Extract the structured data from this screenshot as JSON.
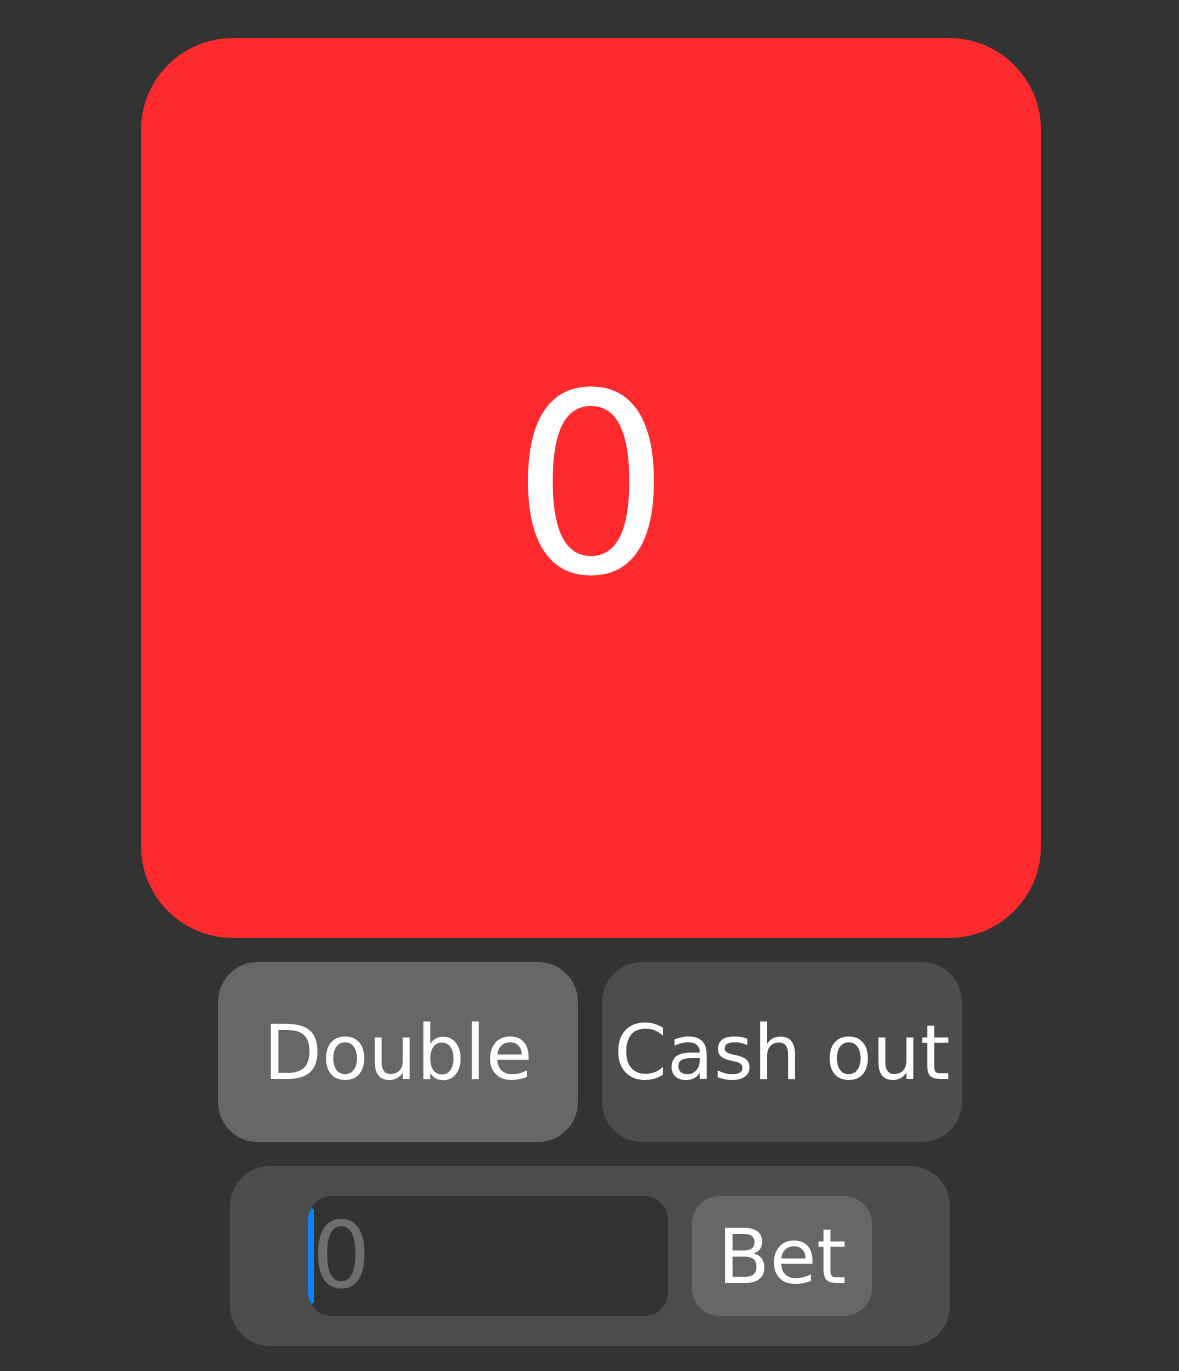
{
  "display": {
    "value": "0",
    "color": "#FF2A2D"
  },
  "controls": {
    "double_label": "Double",
    "cashout_label": "Cash out",
    "double_color": "#676767",
    "cashout_color": "#4D4D4D"
  },
  "bet": {
    "input_placeholder": "0",
    "button_label": "Bet",
    "panel_color": "#4D4D4D",
    "input_color": "#333333",
    "button_color": "#676767",
    "caret_color": "#0A84FF",
    "placeholder_color": "#6E6E6E"
  }
}
